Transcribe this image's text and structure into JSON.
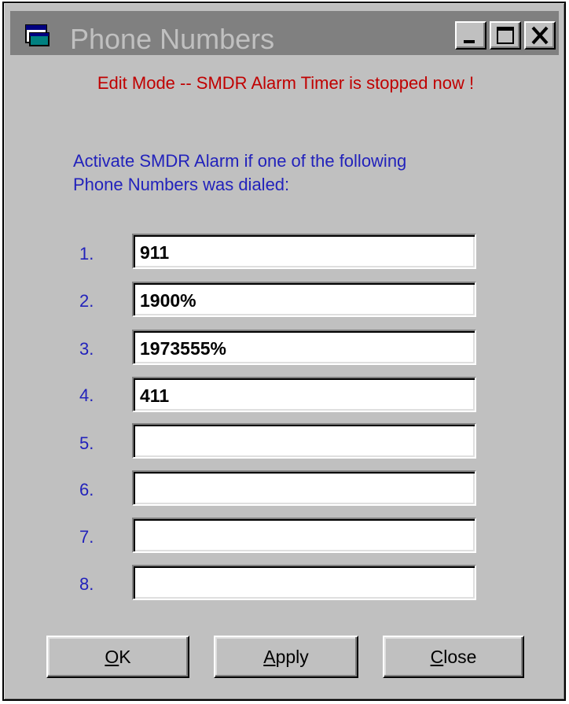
{
  "window": {
    "title": "Phone Numbers",
    "title_icon": "app-window-icon",
    "controls": [
      "minimize-icon",
      "maximize-icon",
      "close-icon"
    ]
  },
  "status": {
    "edit_mode_text": "Edit Mode  --  SMDR Alarm Timer is stopped now !"
  },
  "instruction": {
    "line1": "Activate SMDR Alarm if one of the following",
    "line2": "Phone Numbers was dialed:"
  },
  "phone_numbers": [
    {
      "label": "1.",
      "value": "911"
    },
    {
      "label": "2.",
      "value": "1900%"
    },
    {
      "label": "3.",
      "value": "1973555%"
    },
    {
      "label": "4.",
      "value": "411"
    },
    {
      "label": "5.",
      "value": ""
    },
    {
      "label": "6.",
      "value": ""
    },
    {
      "label": "7.",
      "value": ""
    },
    {
      "label": "8.",
      "value": ""
    }
  ],
  "buttons": {
    "ok": {
      "mnemonic": "O",
      "rest": "K"
    },
    "apply": {
      "mnemonic": "A",
      "rest": "pply"
    },
    "close": {
      "mnemonic": "C",
      "rest": "lose"
    }
  },
  "colors": {
    "window_face": "#c0c0c0",
    "inactive_titlebar": "#808080",
    "inactive_title_text": "#c0c0c0",
    "status_text": "#c00000",
    "label_text": "#2222bb"
  }
}
